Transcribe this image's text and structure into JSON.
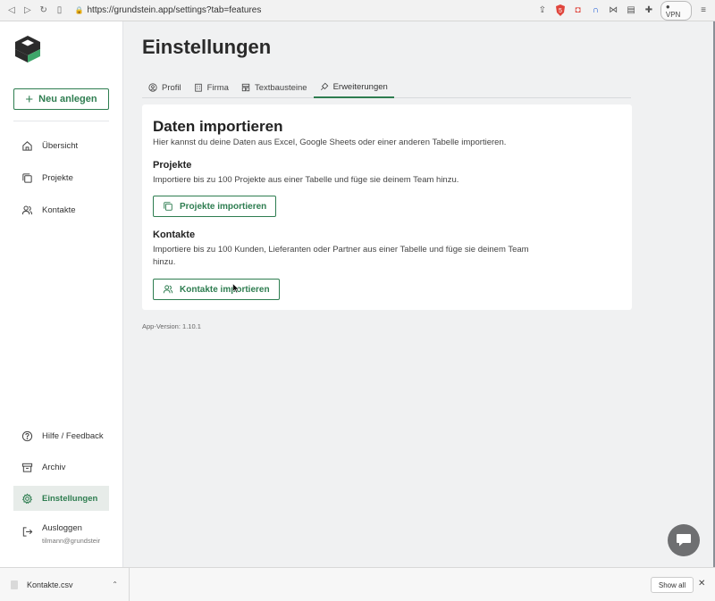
{
  "browser": {
    "url": "https://grundstein.app/settings?tab=features",
    "vpn_label": "VPN",
    "badge_count": "5"
  },
  "sidebar": {
    "new_button": "Neu anlegen",
    "items": [
      {
        "label": "Übersicht"
      },
      {
        "label": "Projekte"
      },
      {
        "label": "Kontakte"
      }
    ],
    "bottom_items": [
      {
        "label": "Hilfe / Feedback"
      },
      {
        "label": "Archiv"
      },
      {
        "label": "Einstellungen"
      }
    ],
    "logout": {
      "label": "Ausloggen",
      "user": "tilmann@grundsteir"
    }
  },
  "page": {
    "title": "Einstellungen",
    "tabs": [
      {
        "label": "Profil"
      },
      {
        "label": "Firma"
      },
      {
        "label": "Textbausteine"
      },
      {
        "label": "Erweiterungen"
      }
    ],
    "active_tab": "Erweiterungen"
  },
  "card": {
    "title": "Daten importieren",
    "description": "Hier kannst du deine Daten aus Excel, Google Sheets oder einer anderen Tabelle importieren.",
    "projects": {
      "title": "Projekte",
      "description": "Importiere bis zu 100 Projekte aus einer Tabelle und füge sie deinem Team hinzu.",
      "button": "Projekte importieren"
    },
    "contacts": {
      "title": "Kontakte",
      "description": "Importiere bis zu 100 Kunden, Lieferanten oder Partner aus einer Tabelle und füge sie deinem Team hinzu.",
      "button": "Kontakte importieren"
    }
  },
  "version": "App-Version: 1.10.1",
  "downloads": {
    "file": "Kontakte.csv",
    "show_all": "Show all"
  },
  "colors": {
    "accent": "#2e7d50",
    "background": "#f0f1f2",
    "sidebar_active": "#e7ece9"
  }
}
